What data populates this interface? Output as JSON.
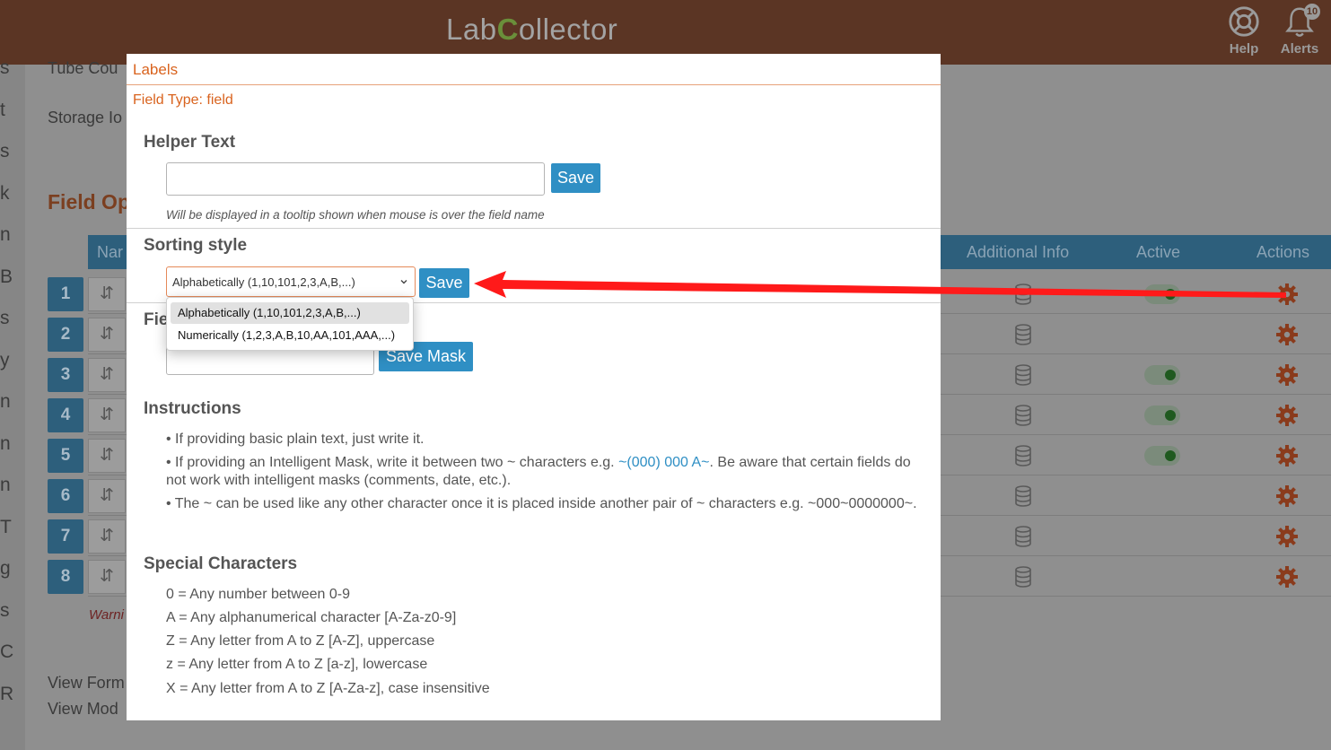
{
  "topbar": {
    "logo_part1": "Lab",
    "logo_part2": "C",
    "logo_part3": "ollector",
    "help_label": "Help",
    "alerts_label": "Alerts",
    "alerts_count": "10"
  },
  "background": {
    "tube_count_label": "Tube Cou",
    "storage_label": "Storage Io",
    "field_options_title": "Field Op",
    "warning_text": "Warni",
    "view_form_label": "View Form",
    "view_mod_label": "View Mod",
    "sidebar_letters": [
      "s",
      "t",
      "s",
      "k",
      "n",
      "B",
      "s",
      "y",
      "n",
      "n",
      "n",
      "T",
      "g",
      "s",
      "C",
      "R"
    ],
    "table_headers": {
      "name": "Nar",
      "additional_info": "Additional Info",
      "active": "Active",
      "actions": "Actions"
    },
    "rows": [
      {
        "num": "1",
        "active": true
      },
      {
        "num": "2",
        "active": false
      },
      {
        "num": "3",
        "active": true
      },
      {
        "num": "4",
        "active": true
      },
      {
        "num": "5",
        "active": true
      },
      {
        "num": "6",
        "active": false
      },
      {
        "num": "7",
        "active": false
      },
      {
        "num": "8",
        "active": false
      }
    ],
    "sort_glyph": "⇵"
  },
  "modal": {
    "title": "Labels",
    "field_type": "Field Type: field",
    "helper_text": {
      "title": "Helper Text",
      "value": "",
      "save_label": "Save",
      "hint": "Will be displayed in a tooltip shown when mouse is over the field name"
    },
    "sorting_style": {
      "title": "Sorting style",
      "selected": "Alphabetically (1,10,101,2,3,A,B,...)",
      "options": [
        "Alphabetically (1,10,101,2,3,A,B,...)",
        "Numerically (1,2,3,A,B,10,AA,101,AAA,...)"
      ],
      "save_label": "Save"
    },
    "field_mask": {
      "title_partial": "Fie",
      "value": "",
      "save_label": "Save Mask"
    },
    "instructions": {
      "title": "Instructions",
      "item1": "• If providing basic plain text, just write it.",
      "item2_prefix": "• If providing an Intelligent Mask, write it between two ~ characters e.g. ",
      "item2_mask": "~(000) 000 A~",
      "item2_suffix": ". Be aware that certain fields do not work with intelligent masks (comments, date, etc.).",
      "item3": "• The ~ can be used like any other character once it is placed inside another pair of ~ characters e.g. ~000~0000000~."
    },
    "special_characters": {
      "title": "Special Characters",
      "items": [
        "0 = Any number between 0-9",
        "A = Any alphanumerical character [A-Za-z0-9]",
        "Z = Any letter from A to Z [A-Z], uppercase",
        "z = Any letter from A to Z [a-z], lowercase",
        "X = Any letter from A to Z [A-Za-z], case insensitive"
      ]
    }
  },
  "colors": {
    "brand_orange": "#d9631e",
    "button_blue": "#2f8fc4",
    "arrow_red": "#ff0000"
  }
}
